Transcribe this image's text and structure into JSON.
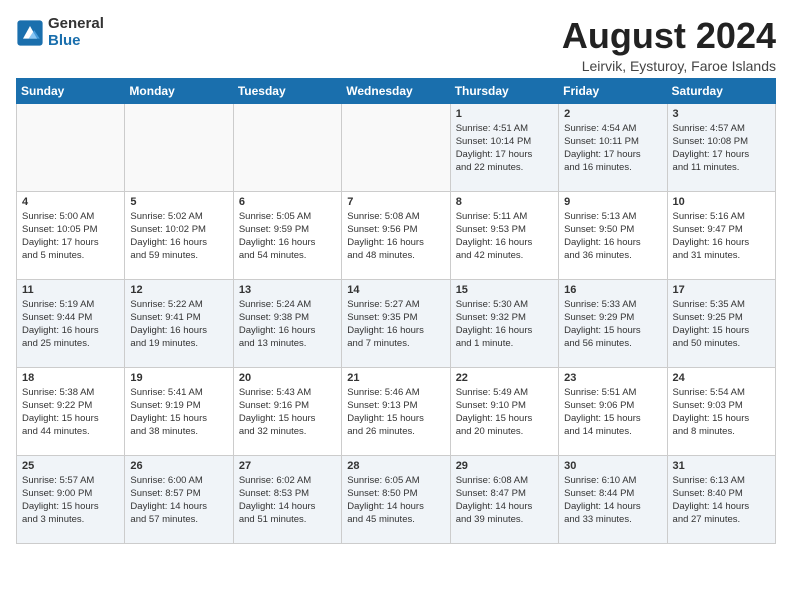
{
  "logo": {
    "general": "General",
    "blue": "Blue"
  },
  "header": {
    "month": "August 2024",
    "location": "Leirvik, Eysturoy, Faroe Islands"
  },
  "weekdays": [
    "Sunday",
    "Monday",
    "Tuesday",
    "Wednesday",
    "Thursday",
    "Friday",
    "Saturday"
  ],
  "weeks": [
    [
      {
        "day": "",
        "info": ""
      },
      {
        "day": "",
        "info": ""
      },
      {
        "day": "",
        "info": ""
      },
      {
        "day": "",
        "info": ""
      },
      {
        "day": "1",
        "info": "Sunrise: 4:51 AM\nSunset: 10:14 PM\nDaylight: 17 hours\nand 22 minutes."
      },
      {
        "day": "2",
        "info": "Sunrise: 4:54 AM\nSunset: 10:11 PM\nDaylight: 17 hours\nand 16 minutes."
      },
      {
        "day": "3",
        "info": "Sunrise: 4:57 AM\nSunset: 10:08 PM\nDaylight: 17 hours\nand 11 minutes."
      }
    ],
    [
      {
        "day": "4",
        "info": "Sunrise: 5:00 AM\nSunset: 10:05 PM\nDaylight: 17 hours\nand 5 minutes."
      },
      {
        "day": "5",
        "info": "Sunrise: 5:02 AM\nSunset: 10:02 PM\nDaylight: 16 hours\nand 59 minutes."
      },
      {
        "day": "6",
        "info": "Sunrise: 5:05 AM\nSunset: 9:59 PM\nDaylight: 16 hours\nand 54 minutes."
      },
      {
        "day": "7",
        "info": "Sunrise: 5:08 AM\nSunset: 9:56 PM\nDaylight: 16 hours\nand 48 minutes."
      },
      {
        "day": "8",
        "info": "Sunrise: 5:11 AM\nSunset: 9:53 PM\nDaylight: 16 hours\nand 42 minutes."
      },
      {
        "day": "9",
        "info": "Sunrise: 5:13 AM\nSunset: 9:50 PM\nDaylight: 16 hours\nand 36 minutes."
      },
      {
        "day": "10",
        "info": "Sunrise: 5:16 AM\nSunset: 9:47 PM\nDaylight: 16 hours\nand 31 minutes."
      }
    ],
    [
      {
        "day": "11",
        "info": "Sunrise: 5:19 AM\nSunset: 9:44 PM\nDaylight: 16 hours\nand 25 minutes."
      },
      {
        "day": "12",
        "info": "Sunrise: 5:22 AM\nSunset: 9:41 PM\nDaylight: 16 hours\nand 19 minutes."
      },
      {
        "day": "13",
        "info": "Sunrise: 5:24 AM\nSunset: 9:38 PM\nDaylight: 16 hours\nand 13 minutes."
      },
      {
        "day": "14",
        "info": "Sunrise: 5:27 AM\nSunset: 9:35 PM\nDaylight: 16 hours\nand 7 minutes."
      },
      {
        "day": "15",
        "info": "Sunrise: 5:30 AM\nSunset: 9:32 PM\nDaylight: 16 hours\nand 1 minute."
      },
      {
        "day": "16",
        "info": "Sunrise: 5:33 AM\nSunset: 9:29 PM\nDaylight: 15 hours\nand 56 minutes."
      },
      {
        "day": "17",
        "info": "Sunrise: 5:35 AM\nSunset: 9:25 PM\nDaylight: 15 hours\nand 50 minutes."
      }
    ],
    [
      {
        "day": "18",
        "info": "Sunrise: 5:38 AM\nSunset: 9:22 PM\nDaylight: 15 hours\nand 44 minutes."
      },
      {
        "day": "19",
        "info": "Sunrise: 5:41 AM\nSunset: 9:19 PM\nDaylight: 15 hours\nand 38 minutes."
      },
      {
        "day": "20",
        "info": "Sunrise: 5:43 AM\nSunset: 9:16 PM\nDaylight: 15 hours\nand 32 minutes."
      },
      {
        "day": "21",
        "info": "Sunrise: 5:46 AM\nSunset: 9:13 PM\nDaylight: 15 hours\nand 26 minutes."
      },
      {
        "day": "22",
        "info": "Sunrise: 5:49 AM\nSunset: 9:10 PM\nDaylight: 15 hours\nand 20 minutes."
      },
      {
        "day": "23",
        "info": "Sunrise: 5:51 AM\nSunset: 9:06 PM\nDaylight: 15 hours\nand 14 minutes."
      },
      {
        "day": "24",
        "info": "Sunrise: 5:54 AM\nSunset: 9:03 PM\nDaylight: 15 hours\nand 8 minutes."
      }
    ],
    [
      {
        "day": "25",
        "info": "Sunrise: 5:57 AM\nSunset: 9:00 PM\nDaylight: 15 hours\nand 3 minutes."
      },
      {
        "day": "26",
        "info": "Sunrise: 6:00 AM\nSunset: 8:57 PM\nDaylight: 14 hours\nand 57 minutes."
      },
      {
        "day": "27",
        "info": "Sunrise: 6:02 AM\nSunset: 8:53 PM\nDaylight: 14 hours\nand 51 minutes."
      },
      {
        "day": "28",
        "info": "Sunrise: 6:05 AM\nSunset: 8:50 PM\nDaylight: 14 hours\nand 45 minutes."
      },
      {
        "day": "29",
        "info": "Sunrise: 6:08 AM\nSunset: 8:47 PM\nDaylight: 14 hours\nand 39 minutes."
      },
      {
        "day": "30",
        "info": "Sunrise: 6:10 AM\nSunset: 8:44 PM\nDaylight: 14 hours\nand 33 minutes."
      },
      {
        "day": "31",
        "info": "Sunrise: 6:13 AM\nSunset: 8:40 PM\nDaylight: 14 hours\nand 27 minutes."
      }
    ]
  ]
}
